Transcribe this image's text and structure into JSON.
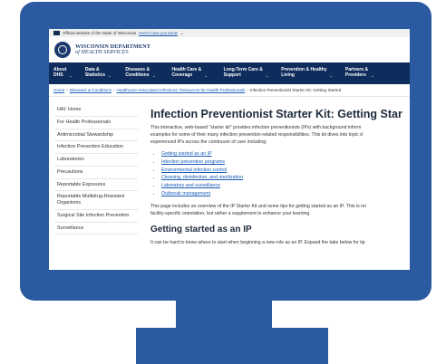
{
  "gov_banner": {
    "text": "Official website of the State of Wisconsin",
    "link": "Here's how you know",
    "chevron": "⌄"
  },
  "logo": {
    "line1": "WISCONSIN DEPARTMENT",
    "line2": "of HEALTH SERVICES",
    "icon": "state-seal-icon"
  },
  "nav": {
    "items": [
      {
        "line1": "About",
        "line2": "DHS"
      },
      {
        "line1": "Data &",
        "line2": "Statistics"
      },
      {
        "line1": "Diseases &",
        "line2": "Conditions"
      },
      {
        "line1": "Health Care &",
        "line2": "Coverage"
      },
      {
        "line1": "Long-Term Care &",
        "line2": "Support"
      },
      {
        "line1": "Prevention & Healthy",
        "line2": "Living"
      },
      {
        "line1": "Partners &",
        "line2": "Providers"
      }
    ],
    "chevron": "⌄"
  },
  "breadcrumb": {
    "home": "Home",
    "sep": "›",
    "diseases": "Diseases & Conditions",
    "hai": "Healthcare-Associated Infections: Resources for Health Professionals",
    "current": "Infection Preventionist Starter Kit: Getting Started"
  },
  "sidebar": {
    "items": [
      "HAI: Home",
      "For Health Professionals",
      "Antimicrobial Stewardship",
      "Infection Prevention Education",
      "Laboratories",
      "Precautions",
      "Reportable Exposures",
      "Reportable Multidrug-Resistant Organisms",
      "Surgical Site Infection Prevention",
      "Surveillance"
    ]
  },
  "main": {
    "title": "Infection Preventionist Starter Kit: Getting Star",
    "intro_l1": "This interactive, web-based \"starter kit\" provides infection preventionists (IPs) with background inform",
    "intro_l2": "examples for some of their many infection prevention-related responsibilities. This kit dives into topic d",
    "intro_l3": "experienced IPs across the continuum of care including:",
    "bullets": [
      "Getting started as an IP",
      "Infection prevention programs",
      "Environmental infection control",
      "Cleaning, disinfection, and sterilization",
      "Laboratory and surveillance",
      "Outbreak management"
    ],
    "overview_l1": "This page includes an overview of the IP Starter Kit and some tips for getting started as an IP. This is no",
    "overview_l2": "facility-specific orientation, but rather a supplement to enhance your learning.",
    "h2": "Getting started as an IP",
    "tip_l1": "It can be hard to know where to start when beginning a new role as an IP. Expand the tabs below for tip"
  },
  "colors": {
    "frame": "#2c5aa0",
    "nav_bg": "#0f2d5c",
    "link": "#1a5bb8",
    "brand": "#1d3a6e"
  }
}
